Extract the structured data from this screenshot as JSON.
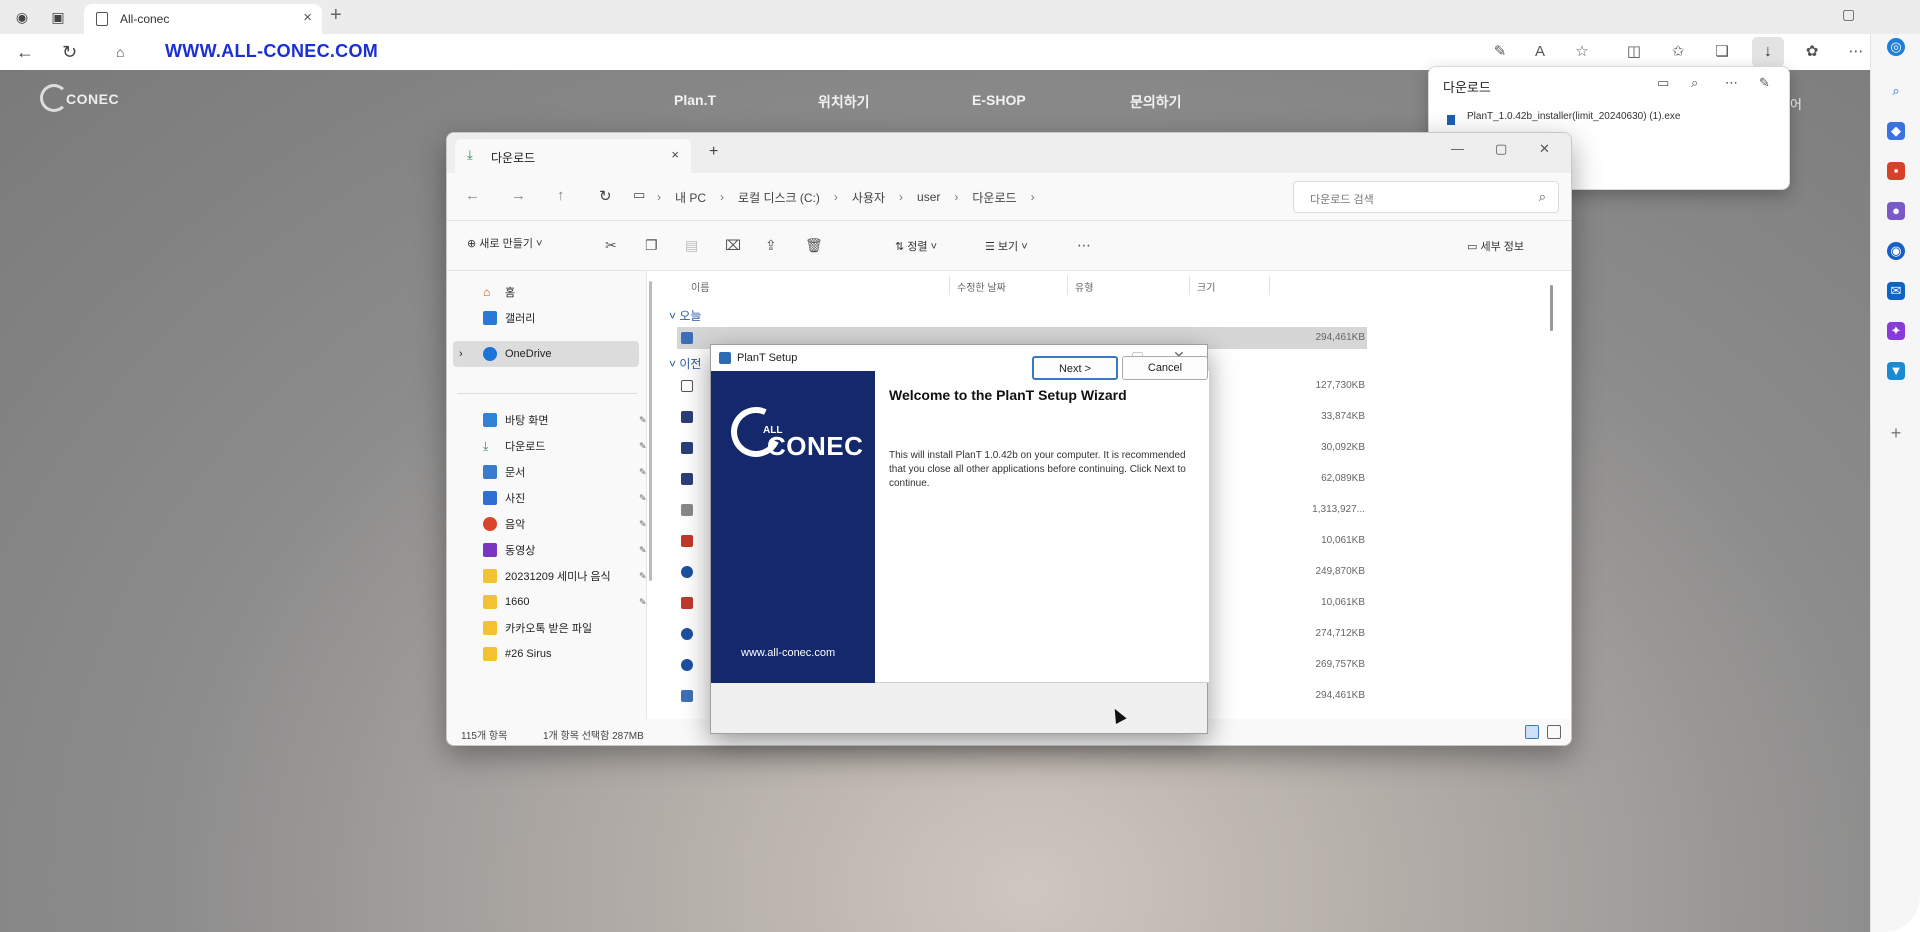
{
  "browser": {
    "tab_title": "All-conec",
    "url": "WWW.ALL-CONEC.COM"
  },
  "site": {
    "logo_text": "CONEC",
    "nav": [
      "Plan.T",
      "위치하기",
      "E-SHOP",
      "문의하기"
    ],
    "lang": "국어"
  },
  "downloads": {
    "title": "다운로드",
    "file": "PlanT_1.0.42b_installer(limit_20240630) (1).exe"
  },
  "explorer": {
    "tab_title": "다운로드",
    "breadcrumb": [
      "내 PC",
      "로컬 디스크 (C:)",
      "사용자",
      "user",
      "다운로드"
    ],
    "search_placeholder": "다운로드 검색",
    "new_label": "새로 만들기",
    "sort_label": "정렬",
    "view_label": "보기",
    "details_label": "세부 정보",
    "nav_items": [
      "홈",
      "갤러리",
      "OneDrive",
      "바탕 화면",
      "다운로드",
      "문서",
      "사진",
      "음악",
      "동영상",
      "20231209 세미나 음식",
      "1660",
      "카카오톡 받은 파일",
      "#26 Sirus"
    ],
    "columns": [
      "이름",
      "수정한 날짜",
      "유형",
      "크기"
    ],
    "group_today": "오늘",
    "group_earlier": "이전",
    "sizes": [
      "294,461KB",
      "127,730KB",
      "33,874KB",
      "30,092KB",
      "62,089KB",
      "1,313,927...",
      "10,061KB",
      "249,870KB",
      "10,061KB",
      "274,712KB",
      "269,757KB",
      "294,461KB"
    ],
    "status_items": "115개 항목",
    "status_selected": "1개 항목 선택함 287MB"
  },
  "setup": {
    "title": "PlanT Setup",
    "heading": "Welcome to the PlanT Setup Wizard",
    "description": "This will install PlanT 1.0.42b on your computer. It is recommended that you close all other applications before continuing. Click Next to continue.",
    "banner_all": "ALL",
    "banner_logo": "CONEC",
    "banner_site": "www.all-conec.com",
    "next_label": "Next >",
    "cancel_label": "Cancel"
  }
}
